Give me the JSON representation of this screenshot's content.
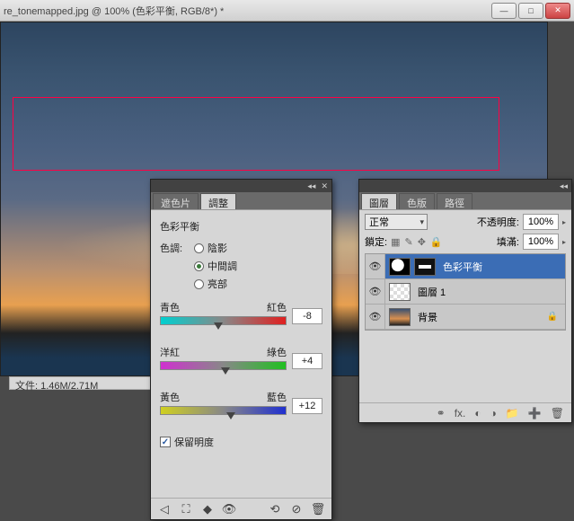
{
  "title_bar": {
    "title": "re_tonemapped.jpg @ 100% (色彩平衡, RGB/8*) *"
  },
  "status_bar": {
    "text": "文件: 1.46M/2.71M"
  },
  "adjust_panel": {
    "tabs": {
      "masks": "遮色片",
      "adjust": "調整"
    },
    "title": "色彩平衡",
    "tone_label": "色調:",
    "tone_options": {
      "shadows": "陰影",
      "midtones": "中間調",
      "highlights": "亮部"
    },
    "sliders": {
      "cr": {
        "left": "青色",
        "right": "紅色",
        "value": "-8",
        "pos": 46
      },
      "mg": {
        "left": "洋紅",
        "right": "綠色",
        "value": "+4",
        "pos": 52
      },
      "yb": {
        "left": "黃色",
        "right": "藍色",
        "value": "+12",
        "pos": 56
      }
    },
    "preserve_lum": "保留明度"
  },
  "layers_panel": {
    "tabs": {
      "layers": "圖層",
      "channels": "色版",
      "paths": "路徑"
    },
    "blend_mode": "正常",
    "opacity_label": "不透明度:",
    "opacity_value": "100%",
    "lock_label": "鎖定:",
    "fill_label": "填滿:",
    "fill_value": "100%",
    "layers": [
      {
        "name": "色彩平衡"
      },
      {
        "name": "圖層 1"
      },
      {
        "name": "背景"
      }
    ]
  }
}
